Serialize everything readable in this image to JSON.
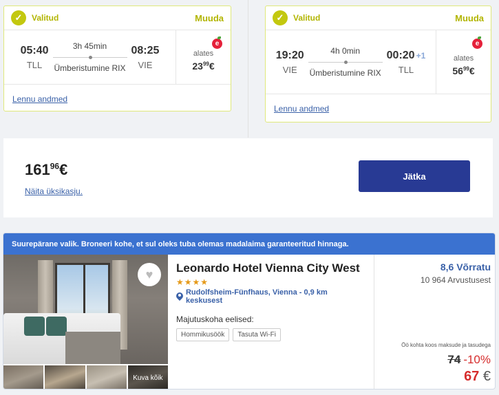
{
  "flights": [
    {
      "selected_label": "Valitud",
      "change_label": "Muuda",
      "dep_time": "05:40",
      "dep_code": "TLL",
      "duration": "3h 45min",
      "stopover": "Ümberistumine RIX",
      "arr_time": "08:25",
      "arr_code": "VIE",
      "day_offset": "",
      "airline_letter": "e",
      "from_label": "alates",
      "price_int": "23",
      "price_dec": "99",
      "currency": "€",
      "details_link": "Lennu andmed"
    },
    {
      "selected_label": "Valitud",
      "change_label": "Muuda",
      "dep_time": "19:20",
      "dep_code": "VIE",
      "duration": "4h 0min",
      "stopover": "Ümberistumine RIX",
      "arr_time": "00:20",
      "arr_code": "TLL",
      "day_offset": "+1",
      "airline_letter": "e",
      "from_label": "alates",
      "price_int": "56",
      "price_dec": "99",
      "currency": "€",
      "details_link": "Lennu andmed"
    }
  ],
  "total": {
    "int": "161",
    "dec": "96",
    "currency": "€",
    "link": "Näita üksikasju.",
    "continue": "Jätka"
  },
  "hotel": {
    "banner": "Suurepärane valik. Broneeri kohe, et sul oleks tuba olemas madalaima garanteeritud hinnaga.",
    "name": "Leonardo Hotel Vienna City West",
    "stars": "★★★★",
    "location": "Rudolfsheim-Fünfhaus, Vienna - 0,9 km keskusest",
    "perks_title": "Majutuskoha eelised:",
    "perks": [
      "Hommikusöök",
      "Tasuta Wi-Fi"
    ],
    "gallery_label": "Kuva kõik",
    "rating": "8,6 Võrratu",
    "reviews": "10 964 Arvustusest",
    "price_note": "Öö kohta koos maksude ja tasudega",
    "old_price": "74",
    "discount": "-10%",
    "new_price": "67",
    "currency": "€"
  },
  "colors": {
    "accent_lime": "#c3c80f",
    "primary_navy": "#283a94",
    "banner_blue": "#3b72d0",
    "link_blue": "#3a61a8",
    "sale_red": "#d62d2d"
  }
}
